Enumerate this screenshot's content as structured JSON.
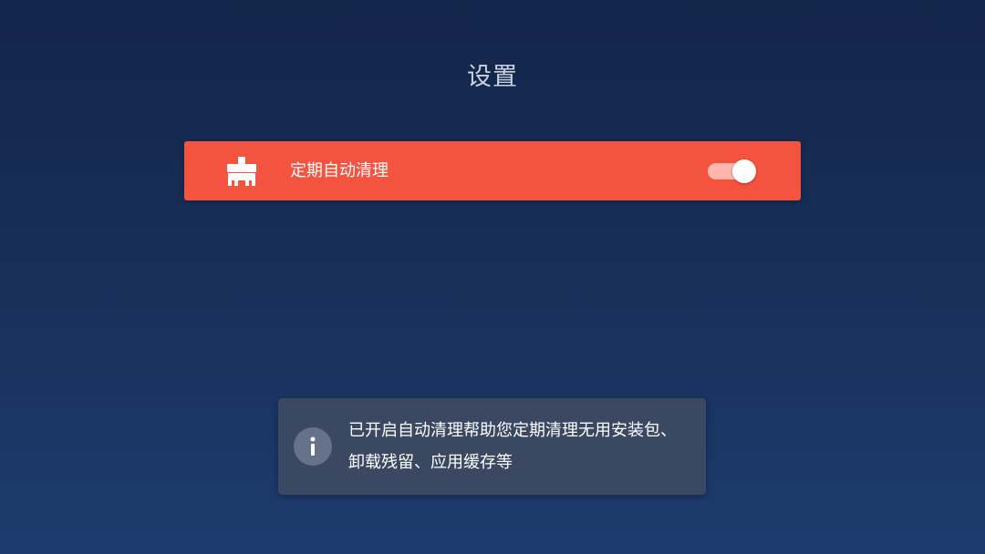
{
  "page": {
    "title": "设置"
  },
  "setting": {
    "label": "定期自动清理",
    "icon": "broom-icon",
    "toggle_on": true,
    "accent_color": "#f4533f"
  },
  "toast": {
    "icon": "info-icon",
    "message": "已开启自动清理帮助您定期清理无用安装包、卸载残留、应用缓存等"
  }
}
